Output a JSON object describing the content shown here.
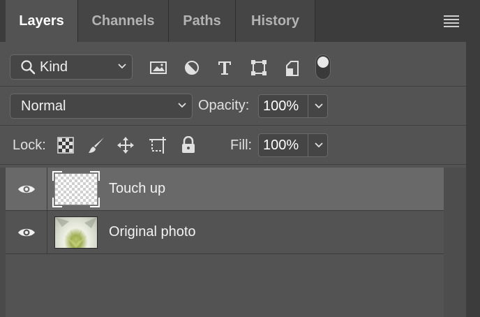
{
  "tabs": [
    {
      "label": "Layers",
      "active": true
    },
    {
      "label": "Channels",
      "active": false
    },
    {
      "label": "Paths",
      "active": false
    },
    {
      "label": "History",
      "active": false
    }
  ],
  "filter": {
    "kind_label": "Kind",
    "icons": [
      "image-filter-icon",
      "adjustment-filter-icon",
      "type-filter-icon",
      "shape-filter-icon",
      "smart-object-filter-icon"
    ],
    "toggle_on": true
  },
  "blend": {
    "mode": "Normal",
    "opacity_label": "Opacity:",
    "opacity_value": "100%"
  },
  "lock": {
    "label": "Lock:",
    "icons": [
      "lock-transparent-pixels-icon",
      "lock-image-pixels-icon",
      "lock-position-icon",
      "lock-artboard-icon",
      "lock-all-icon"
    ],
    "fill_label": "Fill:",
    "fill_value": "100%"
  },
  "layers": [
    {
      "name": "Touch up",
      "visible": true,
      "selected": true,
      "thumbnail": "transparent"
    },
    {
      "name": "Original photo",
      "visible": true,
      "selected": false,
      "thumbnail": "flower-photo"
    }
  ],
  "colors": {
    "panel_bg": "#535353",
    "tab_bg": "#3c3c3c",
    "selected_row": "#696969"
  }
}
